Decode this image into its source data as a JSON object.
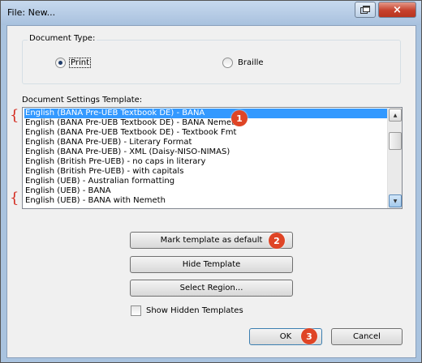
{
  "window": {
    "title": "File: New...",
    "close_glyph": "×",
    "restore_icon": "restore-icon"
  },
  "document_type": {
    "label": "Document Type:",
    "options": [
      {
        "label": "Print",
        "selected": true
      },
      {
        "label": "Braille",
        "selected": false
      }
    ]
  },
  "templates": {
    "label": "Document Settings Template:",
    "items": [
      "English (BANA Pre-UEB Textbook DE) - BANA",
      "English (BANA Pre-UEB Textbook DE) - BANA Nemeth",
      "English (BANA Pre-UEB Textbook DE) - Textbook Fmt",
      "English (BANA Pre-UEB) - Literary Format",
      "English (BANA Pre-UEB) - XML (Daisy-NISO-NIMAS)",
      "English (British Pre-UEB) - no caps in literary",
      "English (British Pre-UEB) - with capitals",
      "English (UEB) - Australian formatting",
      "English (UEB) - BANA",
      "English (UEB) - BANA with Nemeth"
    ],
    "selected_index": 0,
    "bracket_glyph": "{"
  },
  "buttons": {
    "mark_default": "Mark template as default",
    "hide_template": "Hide Template",
    "select_region": "Select Region...",
    "ok": "OK",
    "cancel": "Cancel"
  },
  "show_hidden": {
    "label": "Show Hidden Templates",
    "checked": false
  },
  "badges": [
    "1",
    "2",
    "3"
  ],
  "colors": {
    "badge": "#df4526",
    "selection": "#3399ff",
    "bracket": "#d42a1e"
  }
}
